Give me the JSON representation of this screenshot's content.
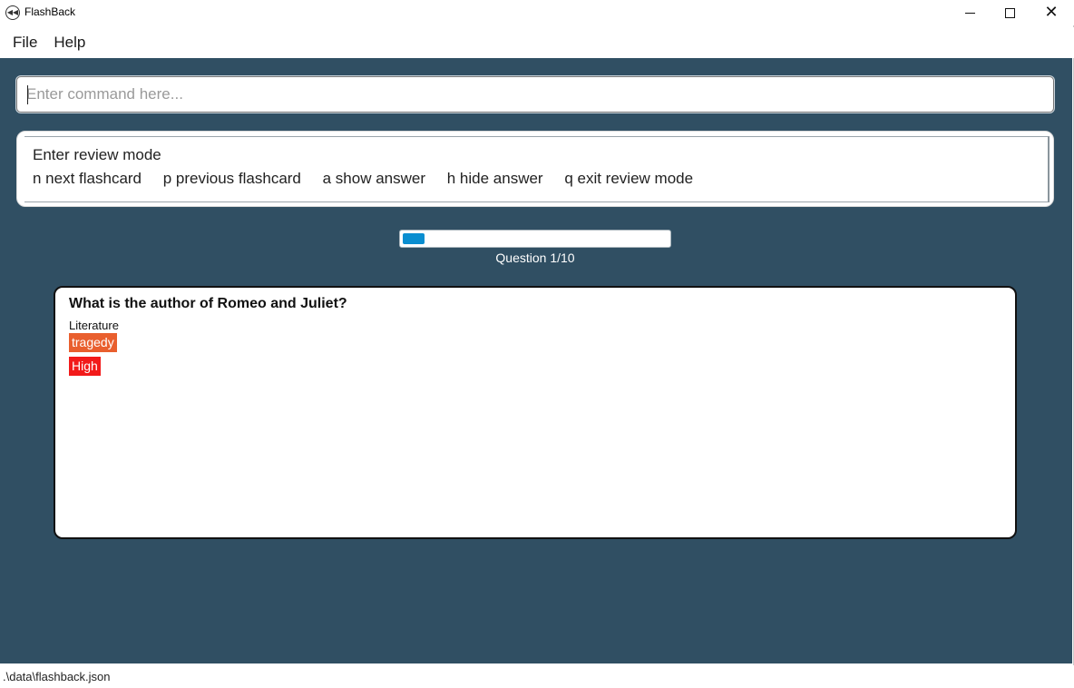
{
  "window": {
    "title": "FlashBack",
    "controls": {
      "minimize": "minimize",
      "maximize": "maximize",
      "close": "close"
    }
  },
  "menu": {
    "items": [
      {
        "label": "File"
      },
      {
        "label": "Help"
      }
    ]
  },
  "command": {
    "placeholder": "Enter command here...",
    "value": ""
  },
  "result": {
    "line1": "Enter review mode",
    "commands": [
      "n next flashcard",
      "p previous flashcard",
      "a show answer",
      "h hide answer",
      "q exit review mode"
    ]
  },
  "progress": {
    "fraction": 0.1,
    "label": "Question 1/10"
  },
  "card": {
    "question": "What is the author of Romeo and Juliet?",
    "category": "Literature",
    "tag": "tragedy",
    "priority": "High"
  },
  "colors": {
    "background": "#304f63",
    "progress_fill": "#0a8ed0",
    "tag_color": "#e95f2e",
    "priority_color": "#f21a1a"
  },
  "status": {
    "file_path": ".\\data\\flashback.json"
  }
}
